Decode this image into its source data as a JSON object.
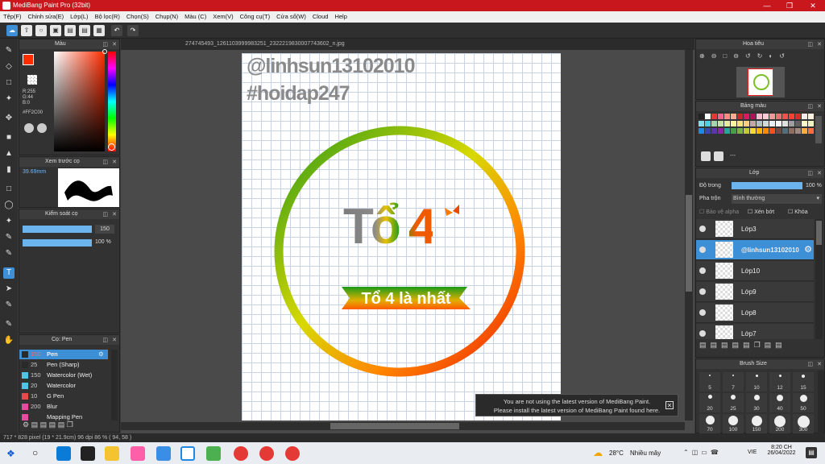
{
  "window": {
    "title": "MediBang Paint Pro (32bit)"
  },
  "menu": [
    "Tệp(F)",
    "Chỉnh sửa(E)",
    "Lớp(L)",
    "Bộ lọc(R)",
    "Chọn(S)",
    "Chụp(N)",
    "Màu (C)",
    "Xem(V)",
    "Công cụ(T)",
    "Cửa sổ(W)",
    "Cloud",
    "Help"
  ],
  "color_panel": {
    "title": "Màu",
    "r": "R:255",
    "g": "G:44",
    "b": "B:0",
    "hex": "#FF2C00",
    "fg_color": "#ff2c00"
  },
  "preview_panel": {
    "title": "Xem trước cọ",
    "size": "39.69mm"
  },
  "brush_control": {
    "title": "Kiểm soát cọ",
    "size": "150",
    "opacity": "100 %"
  },
  "brush_panel": {
    "title": "Cọ: Pen",
    "items": [
      {
        "size": "150",
        "name": "Pen",
        "color": "#2a2a2a"
      },
      {
        "size": "25",
        "name": "Pen (Sharp)",
        "color": "#2a2a2a"
      },
      {
        "size": "150",
        "name": "Watercolor (Wet)",
        "color": "#4fc3e8"
      },
      {
        "size": "20",
        "name": "Watercolor",
        "color": "#4fc3e8"
      },
      {
        "size": "10",
        "name": "G Pen",
        "color": "#e84a4a"
      },
      {
        "size": "200",
        "name": "Blur",
        "color": "#e84aa0"
      },
      {
        "size": "",
        "name": "Mapping Pen",
        "color": "#e84aa0"
      }
    ]
  },
  "document": {
    "tab": "274745493_1261103999983251_2322219830007743602_n.jpg"
  },
  "artwork": {
    "watermark1": "@linhsun13102010",
    "watermark2": "#hoidap247",
    "logo_text": "Tổ 4",
    "banner_text": "Tổ 4 là nhất"
  },
  "notice": {
    "line1": "You are not using the latest version of MediBang Paint.",
    "line2": "Please install the latest version of MediBang Paint found here."
  },
  "navigator": {
    "title": "Hoa tiêu"
  },
  "palette": {
    "title": "Bảng màu",
    "label": "---"
  },
  "layers": {
    "title": "Lớp",
    "opacity_label": "Độ trong",
    "opacity_value": "100 %",
    "blend_label": "Pha trộn",
    "blend_value": "Bình thường",
    "protect_alpha": "Bảo vệ alpha",
    "clipping": "Xén bớt",
    "lock": "Khóa",
    "items": [
      {
        "name": "Lớp3"
      },
      {
        "name": "@linhsun13102010"
      },
      {
        "name": "Lớp10"
      },
      {
        "name": "Lớp9"
      },
      {
        "name": "Lớp8"
      },
      {
        "name": "Lớp7"
      }
    ]
  },
  "brush_size": {
    "title": "Brush Size",
    "row1": [
      "5",
      "7",
      "10",
      "12",
      "15"
    ],
    "row2": [
      "20",
      "25",
      "30",
      "40",
      "50"
    ],
    "row3": [
      "70",
      "100",
      "150",
      "200",
      "300"
    ]
  },
  "status": {
    "text": "717 * 828 pixel  (19 * 21.9cm)  96 dpi  86 %  ( 94, 58 )"
  },
  "taskbar": {
    "weather_temp": "28°C",
    "weather_text": "Nhiều mây",
    "lang": "VIE",
    "time": "8:20 CH",
    "date": "26/04/2022"
  }
}
